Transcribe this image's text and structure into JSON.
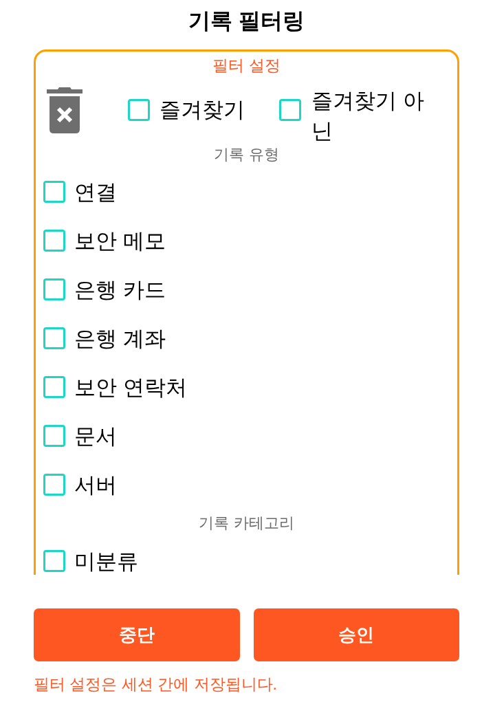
{
  "title": "기록 필터링",
  "filter_panel": {
    "heading": "필터 설정",
    "favorites": [
      {
        "label": "즐겨찾기",
        "checked": false
      },
      {
        "label": "즐겨찾기 아닌",
        "checked": false
      }
    ],
    "sections": [
      {
        "heading": "기록 유형",
        "items": [
          {
            "label": "연결",
            "checked": false
          },
          {
            "label": "보안 메모",
            "checked": false
          },
          {
            "label": "은행 카드",
            "checked": false
          },
          {
            "label": "은행 계좌",
            "checked": false
          },
          {
            "label": "보안 연락처",
            "checked": false
          },
          {
            "label": "문서",
            "checked": false
          },
          {
            "label": "서버",
            "checked": false
          }
        ]
      },
      {
        "heading": "기록 카테고리",
        "items": [
          {
            "label": "미분류",
            "checked": false
          }
        ]
      }
    ]
  },
  "buttons": [
    {
      "label": "중단"
    },
    {
      "label": "승인"
    }
  ],
  "footer_note": "필터 설정은 세션 간에 저장됩니다."
}
